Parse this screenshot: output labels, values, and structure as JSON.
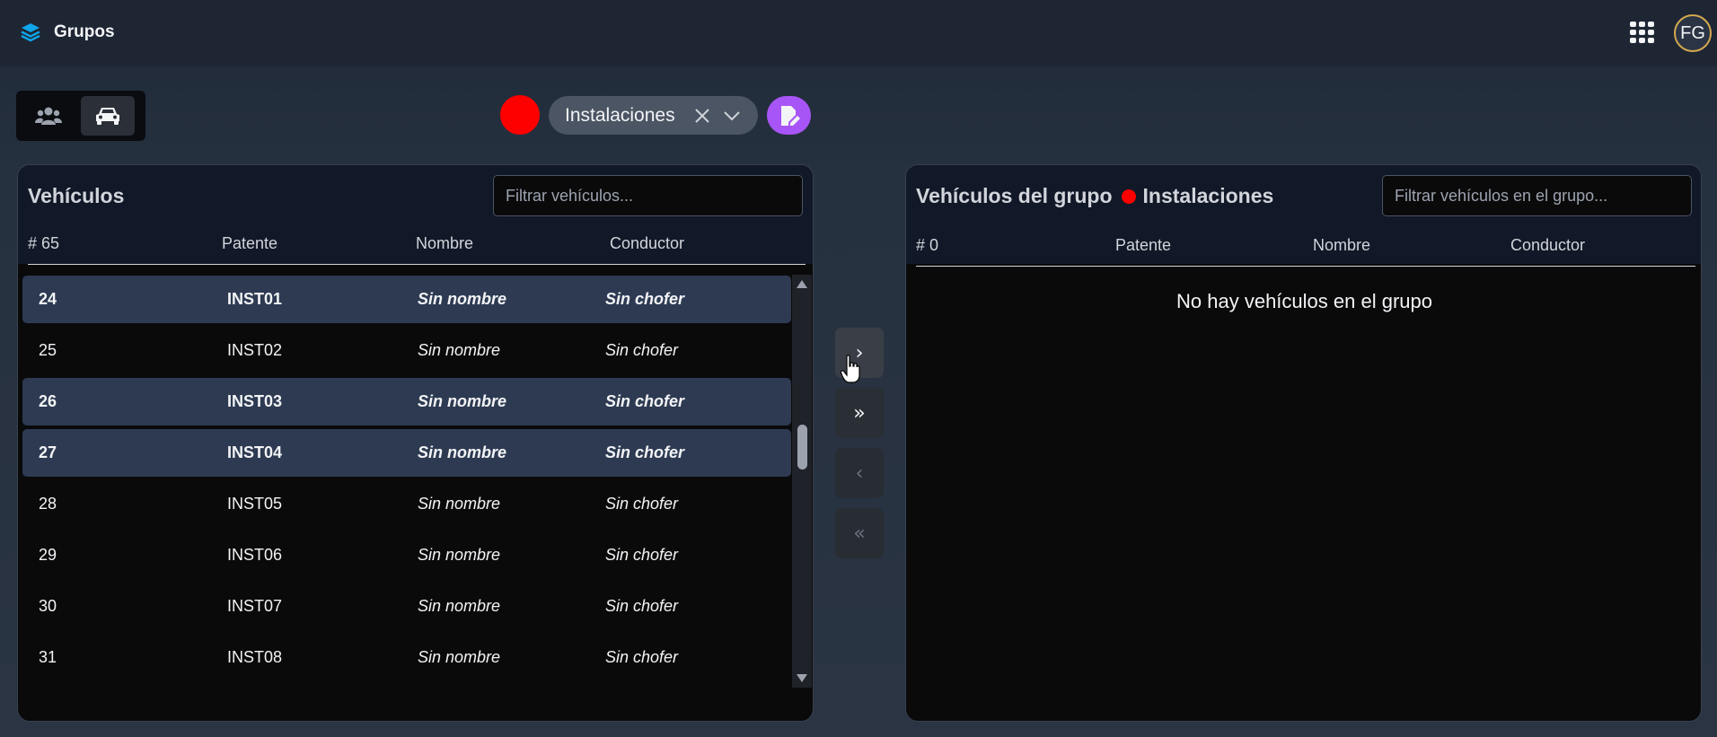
{
  "header": {
    "title": "Grupos",
    "avatar_initials": "FG",
    "brand_icon": "layers-icon",
    "apps_icon": "grid-apps-icon"
  },
  "toolbar": {
    "toggle": [
      {
        "icon": "users-icon",
        "active": false
      },
      {
        "icon": "car-icon",
        "active": true
      }
    ],
    "group_color": "#ff0000",
    "group_name": "Instalaciones",
    "accent": "#a855f7"
  },
  "left": {
    "title": "Vehículos",
    "filter_placeholder": "Filtrar vehículos...",
    "count_label": "# 65",
    "col_patente": "Patente",
    "col_nombre": "Nombre",
    "col_conductor": "Conductor",
    "rows": [
      {
        "num": "24",
        "patente": "INST01",
        "nombre": "Sin nombre",
        "conductor": "Sin chofer",
        "selected": true
      },
      {
        "num": "25",
        "patente": "INST02",
        "nombre": "Sin nombre",
        "conductor": "Sin chofer",
        "selected": false
      },
      {
        "num": "26",
        "patente": "INST03",
        "nombre": "Sin nombre",
        "conductor": "Sin chofer",
        "selected": true
      },
      {
        "num": "27",
        "patente": "INST04",
        "nombre": "Sin nombre",
        "conductor": "Sin chofer",
        "selected": true
      },
      {
        "num": "28",
        "patente": "INST05",
        "nombre": "Sin nombre",
        "conductor": "Sin chofer",
        "selected": false
      },
      {
        "num": "29",
        "patente": "INST06",
        "nombre": "Sin nombre",
        "conductor": "Sin chofer",
        "selected": false
      },
      {
        "num": "30",
        "patente": "INST07",
        "nombre": "Sin nombre",
        "conductor": "Sin chofer",
        "selected": false
      },
      {
        "num": "31",
        "patente": "INST08",
        "nombre": "Sin nombre",
        "conductor": "Sin chofer",
        "selected": false
      }
    ]
  },
  "transfer": {
    "move_one": "›",
    "move_all": "»",
    "back_one": "‹",
    "back_all": "«"
  },
  "right": {
    "title": "Vehículos del grupo",
    "group_name": "Instalaciones",
    "filter_placeholder": "Filtrar vehículos en el grupo...",
    "count_label": "# 0",
    "col_patente": "Patente",
    "col_nombre": "Nombre",
    "col_conductor": "Conductor",
    "empty_message": "No hay vehículos en el grupo"
  }
}
